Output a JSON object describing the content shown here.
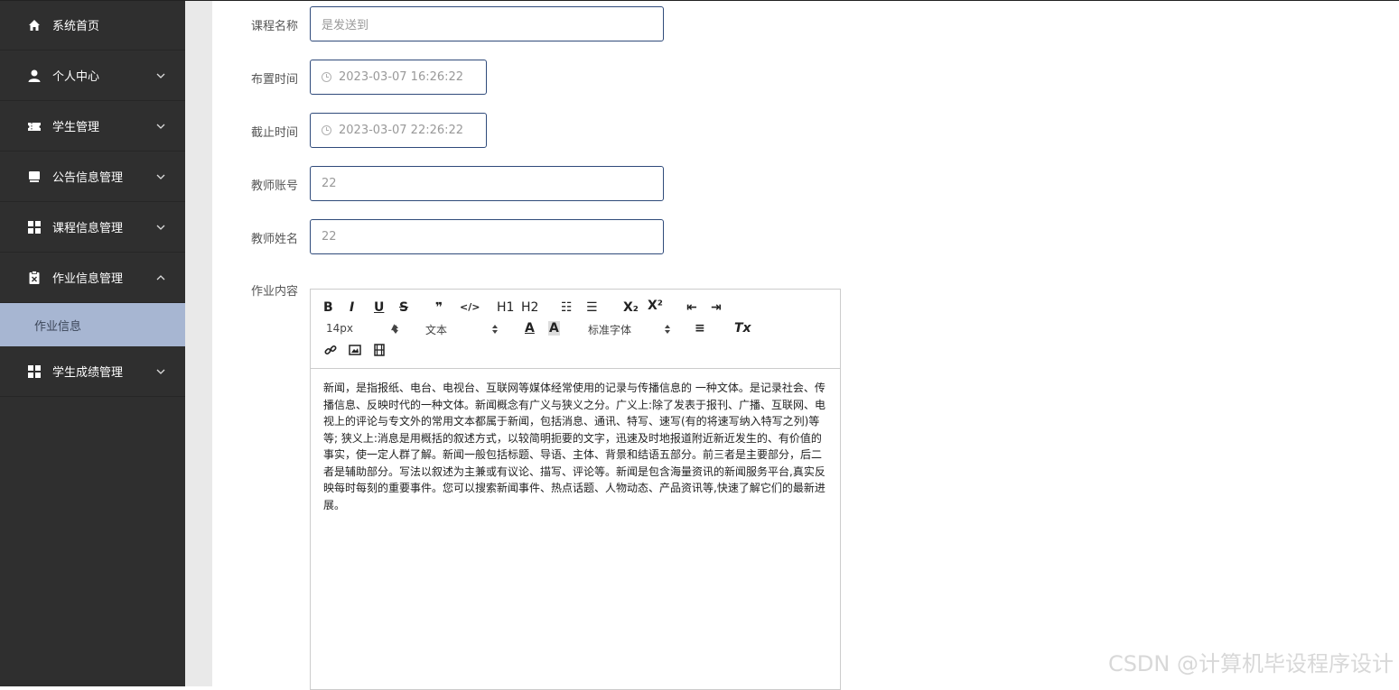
{
  "sidebar": {
    "items": [
      {
        "label": "系统首页",
        "icon": "home-icon"
      },
      {
        "label": "个人中心",
        "icon": "user-icon"
      },
      {
        "label": "学生管理",
        "icon": "ticket-icon"
      },
      {
        "label": "公告信息管理",
        "icon": "monitor-icon"
      },
      {
        "label": "课程信息管理",
        "icon": "grid-icon"
      },
      {
        "label": "作业信息管理",
        "icon": "clipboard-icon"
      },
      {
        "label": "学生成绩管理",
        "icon": "grid-icon"
      }
    ],
    "sub_item": "作业信息"
  },
  "form": {
    "course_name": {
      "label": "课程名称",
      "value": "是发送到"
    },
    "assign_time": {
      "label": "布置时间",
      "value": "2023-03-07 16:26:22"
    },
    "deadline": {
      "label": "截止时间",
      "value": "2023-03-07 22:26:22"
    },
    "teacher_account": {
      "label": "教师账号",
      "value": "22"
    },
    "teacher_name": {
      "label": "教师姓名",
      "value": "22"
    },
    "homework_content": {
      "label": "作业内容"
    }
  },
  "editor": {
    "toolbar": {
      "bold": "B",
      "italic": "I",
      "underline": "U",
      "strike": "S",
      "quote": "❞",
      "code": "</>",
      "h1": "H1",
      "h2": "H2",
      "ordered_list": "☷",
      "bullet_list": "☰",
      "subscript": "X₂",
      "superscript": "X²",
      "outdent": "⇤",
      "indent": "⇥",
      "size": "14px",
      "header": "文本",
      "color": "A",
      "background": "A",
      "font": "标准字体",
      "align": "≡",
      "clean": "Tx"
    },
    "content": "新闻，是指报纸、电台、电视台、互联网等媒体经常使用的记录与传播信息的 一种文体。是记录社会、传播信息、反映时代的一种文体。新闻概念有广义与狭义之分。广义上:除了发表于报刊、广播、互联网、电视上的评论与专文外的常用文本都属于新闻，包括消息、通讯、特写、速写(有的将速写纳入特写之列)等等; 狭义上:消息是用概括的叙述方式，以较简明扼要的文字，迅速及时地报道附近新近发生的、有价值的事实，使一定人群了解。新闻一般包括标题、导语、主体、背景和结语五部分。前三者是主要部分，后二者是辅助部分。写法以叙述为主兼或有议论、描写、评论等。新闻是包含海量资讯的新闻服务平台,真实反映每时每刻的重要事件。您可以搜索新闻事件、热点话题、人物动态、产品资讯等,快速了解它们的最新进展。"
  },
  "watermark": "CSDN @计算机毕设程序设计"
}
